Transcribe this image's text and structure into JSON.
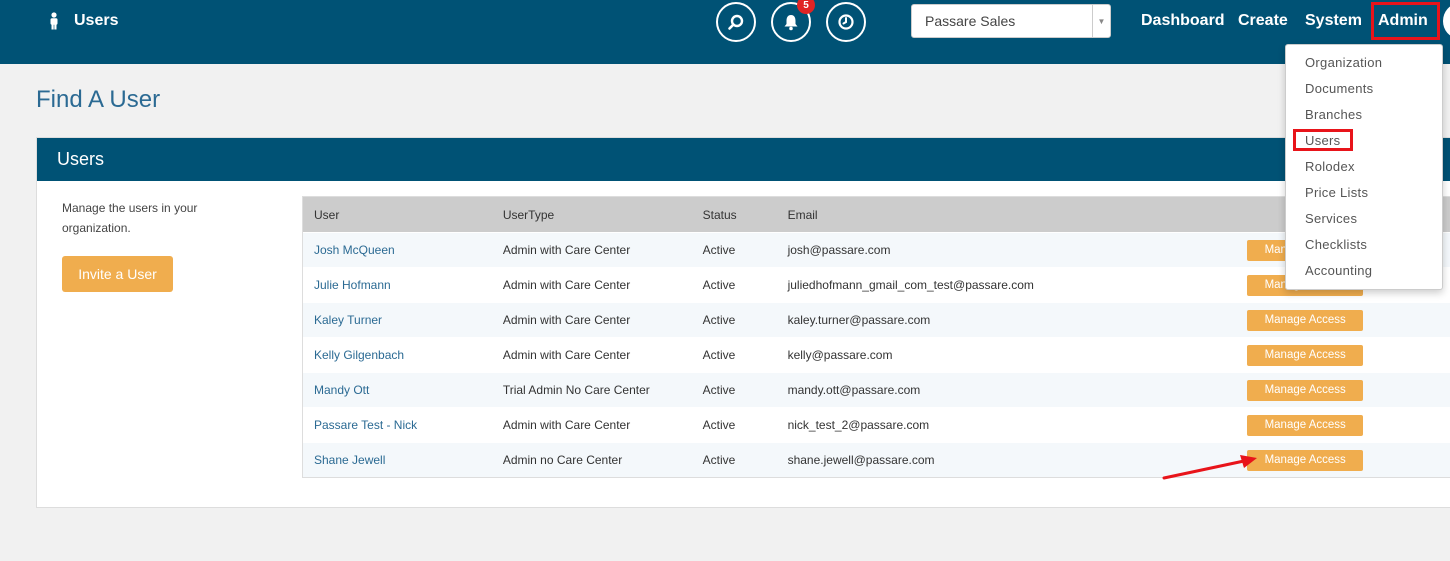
{
  "topbar": {
    "title": "Users",
    "notifications_count": "5",
    "org_select": "Passare Sales",
    "nav": [
      "Dashboard",
      "Create",
      "System",
      "Admin"
    ]
  },
  "page": {
    "title": "Find A User"
  },
  "panel": {
    "title": "Users",
    "description": "Manage the users in your organization.",
    "invite_label": "Invite a User"
  },
  "table": {
    "headers": [
      "User",
      "UserType",
      "Status",
      "Email"
    ],
    "action_label": "Manage Access",
    "rows": [
      {
        "user": "Josh McQueen",
        "type": "Admin with Care Center",
        "status": "Active",
        "email": "josh@passare.com"
      },
      {
        "user": "Julie Hofmann",
        "type": "Admin with Care Center",
        "status": "Active",
        "email": "juliedhofmann_gmail_com_test@passare.com"
      },
      {
        "user": "Kaley Turner",
        "type": "Admin with Care Center",
        "status": "Active",
        "email": "kaley.turner@passare.com"
      },
      {
        "user": "Kelly Gilgenbach",
        "type": "Admin with Care Center",
        "status": "Active",
        "email": "kelly@passare.com"
      },
      {
        "user": "Mandy Ott",
        "type": "Trial Admin No Care Center",
        "status": "Active",
        "email": "mandy.ott@passare.com"
      },
      {
        "user": "Passare Test - Nick",
        "type": "Admin with Care Center",
        "status": "Active",
        "email": "nick_test_2@passare.com"
      },
      {
        "user": "Shane Jewell",
        "type": "Admin no Care Center",
        "status": "Active",
        "email": "shane.jewell@passare.com"
      }
    ]
  },
  "admin_menu": [
    "Organization",
    "Documents",
    "Branches",
    "Users",
    "Rolodex",
    "Price Lists",
    "Services",
    "Checklists",
    "Accounting"
  ],
  "colors": {
    "navbar": "#005275",
    "accent": "#f0ad4e",
    "link": "#2b6a93",
    "highlight": "#e8141a",
    "badge": "#e02424"
  },
  "icons": [
    "person-icon",
    "search-icon",
    "bell-icon",
    "clock-icon",
    "caret-down-icon"
  ]
}
